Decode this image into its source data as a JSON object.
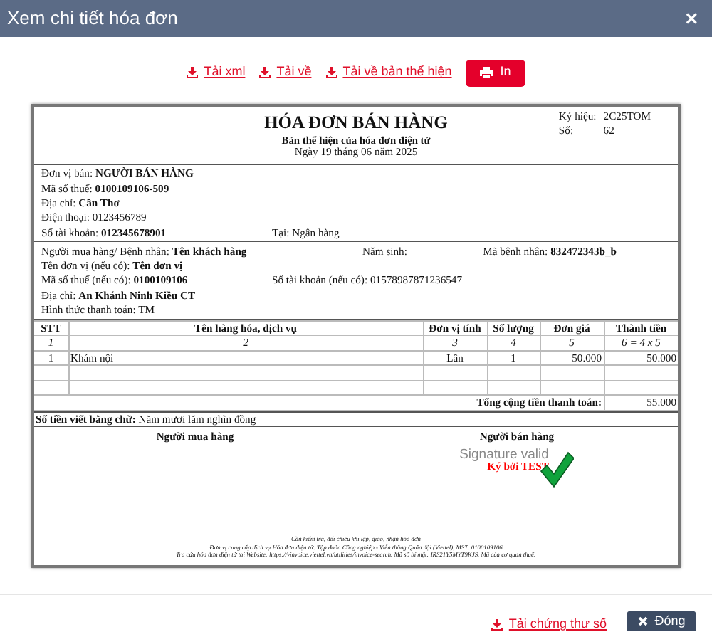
{
  "modal": {
    "title": "Xem chi tiết hóa đơn",
    "close": "×"
  },
  "actions": [
    {
      "label": "Tải xml",
      "kind": "link"
    },
    {
      "label": "Tải về",
      "kind": "link"
    },
    {
      "label": "Tải về bản thể hiện",
      "kind": "link"
    },
    {
      "label": "In",
      "kind": "button"
    }
  ],
  "invoice": {
    "title": "HÓA ĐƠN BÁN HÀNG",
    "subtitle": "Bản thể hiện của hóa đơn điện tử",
    "date": "Ngày 19 tháng 06 năm 2025",
    "meta": [
      {
        "label": "Ký hiệu:",
        "value": "2C25TOM"
      },
      {
        "label": "Số:",
        "value": "62"
      }
    ],
    "seller": [
      [
        {
          "label": "Đơn vị bán:",
          "value": "NGƯỜI BÁN HÀNG",
          "bold": true
        }
      ],
      [
        {
          "label": "Mã số thuế:",
          "value": "0100109106-509",
          "bold": true
        }
      ],
      [
        {
          "label": "Địa chỉ:",
          "value": "Cần Thơ",
          "bold": true
        }
      ],
      [
        {
          "label": "Điện thoại:",
          "value": "0123456789",
          "bold": false
        }
      ],
      [
        {
          "label": "Số tài khoản:",
          "value": "012345678901",
          "bold": true
        },
        {
          "label": "Tại:",
          "value": "Ngân hàng",
          "bold": false
        }
      ]
    ],
    "buyer": [
      [
        {
          "label": "Người mua hàng/ Bệnh nhân:",
          "value": "Tên khách hàng",
          "bold": true
        },
        {
          "label": "Năm sinh:"
        },
        {
          "label": "Mã bệnh nhân:",
          "value": "832472343b_b",
          "bold": true
        }
      ],
      [
        {
          "label": "Tên đơn vị (nếu có):",
          "value": "Tên đơn vị",
          "bold": true
        }
      ],
      [
        {
          "label": "Mã số thuế (nếu có):",
          "value": "0100109106",
          "bold": true
        },
        {
          "label": "Số tài khoản (nếu có):",
          "value": "01578987871236547",
          "bold": false
        }
      ],
      [
        {
          "label": "Địa chỉ:",
          "value": "An Khánh Ninh Kiều CT",
          "bold": true
        }
      ],
      [
        {
          "label": "Hình thức thanh toán:",
          "value": "TM",
          "bold": false
        }
      ]
    ],
    "table": {
      "columns": [
        "STT",
        "Tên hàng hóa, dịch vụ",
        "Đơn vị tính",
        "Số lượng",
        "Đơn giá",
        "Thành tiền"
      ],
      "index_row": [
        "1",
        "2",
        "3",
        "4",
        "5",
        "6 = 4 x 5"
      ],
      "rows": [
        {
          "kind": "item",
          "cells": [
            "1",
            "Khám nội",
            "Lần",
            "1",
            "50.000",
            "50.000"
          ]
        },
        {
          "kind": "blank"
        },
        {
          "kind": "blank"
        }
      ],
      "total": {
        "label": "Tổng cộng tiền thanh toán:",
        "value": "55.000"
      }
    },
    "amount_in_words": {
      "label": "Số tiền viết bằng chữ:",
      "value": "Năm mươi lăm nghìn đồng"
    },
    "signatures": [
      {
        "label": "Người mua hàng"
      },
      {
        "label": "Người bán hàng",
        "signature": {
          "status": "Signature valid",
          "signer": "Ký bởi TEST"
        }
      }
    ],
    "footnotes": [
      "Cần kiểm tra, đối chiếu khi lập, giao, nhận hóa đơn",
      "Đơn vị cung cấp dịch vụ Hóa đơn điện tử: Tập đoàn Công nghiệp - Viễn thông Quân đội (Viettel), MST: 0100109106",
      "Tra cứu hóa đơn điện tử tại Website: https://vinvoice.viettel.vn/utilities/invoice-search. Mã số bí mật: IRS21Y5MYT9KJS. Mã của cơ quan thuế:"
    ]
  },
  "footer": [
    {
      "label": "Tải chứng thư số",
      "kind": "link"
    },
    {
      "label": "Đóng",
      "kind": "button"
    }
  ]
}
